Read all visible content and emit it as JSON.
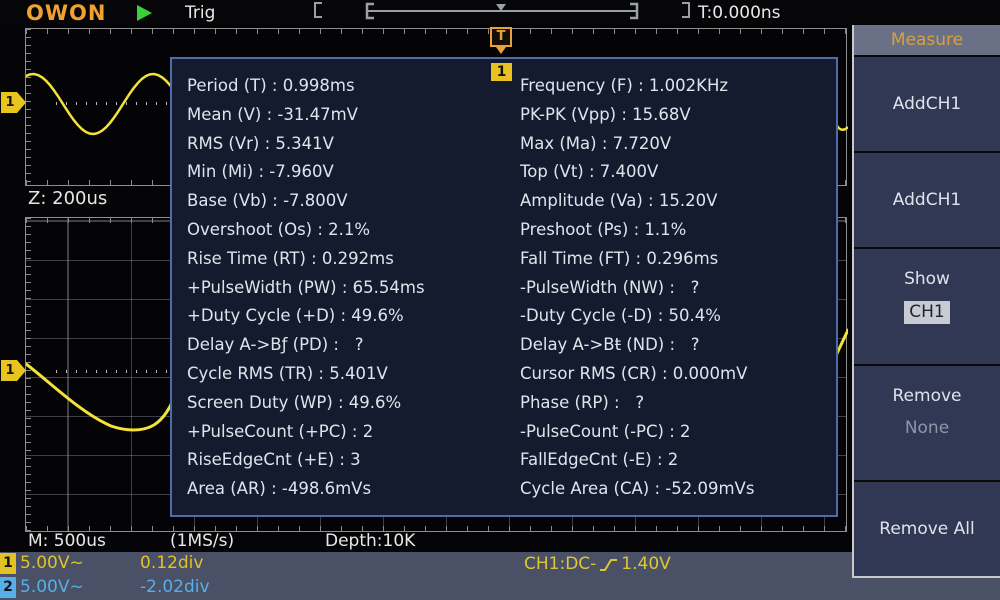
{
  "topbar": {
    "logo": "OWON",
    "trigger_status": "Trig",
    "trigger_time": "T:0.000ns"
  },
  "zoom_window": {
    "label": "Z: 200us"
  },
  "trigger_flag": "T",
  "measure_panel": {
    "channel_badge": "1",
    "left": [
      {
        "label": "Period (T)",
        "value": "0.998ms"
      },
      {
        "label": "Mean (V)",
        "value": "-31.47mV"
      },
      {
        "label": "RMS (Vr)",
        "value": "5.341V"
      },
      {
        "label": "Min (Mi)",
        "value": "-7.960V"
      },
      {
        "label": "Base (Vb)",
        "value": "-7.800V"
      },
      {
        "label": "Overshoot (Os)",
        "value": "2.1%"
      },
      {
        "label": "Rise Time (RT)",
        "value": "0.292ms"
      },
      {
        "label": "+PulseWidth (PW)",
        "value": "65.54ms"
      },
      {
        "label": "+Duty Cycle (+D)",
        "value": "49.6%"
      },
      {
        "label": "Delay A->Bƒ (PD)",
        "value": "  ?"
      },
      {
        "label": "Cycle RMS (TR)",
        "value": "5.401V"
      },
      {
        "label": "Screen Duty (WP)",
        "value": "49.6%"
      },
      {
        "label": "+PulseCount (+PC)",
        "value": "2"
      },
      {
        "label": "RiseEdgeCnt (+E)",
        "value": "3"
      },
      {
        "label": "Area (AR)",
        "value": "-498.6mVs"
      }
    ],
    "right": [
      {
        "label": "Frequency (F)",
        "value": "1.002KHz"
      },
      {
        "label": "PK-PK (Vpp)",
        "value": "15.68V"
      },
      {
        "label": "Max (Ma)",
        "value": "7.720V"
      },
      {
        "label": "Top (Vt)",
        "value": "7.400V"
      },
      {
        "label": "Amplitude (Va)",
        "value": "15.20V"
      },
      {
        "label": "Preshoot (Ps)",
        "value": "1.1%"
      },
      {
        "label": "Fall Time (FT)",
        "value": "0.296ms"
      },
      {
        "label": "-PulseWidth (NW)",
        "value": "  ?"
      },
      {
        "label": "-Duty Cycle (-D)",
        "value": "50.4%"
      },
      {
        "label": "Delay A->Bŧ (ND)",
        "value": "  ?"
      },
      {
        "label": "Cursor RMS (CR)",
        "value": "0.000mV"
      },
      {
        "label": "Phase (RP)",
        "value": "  ?"
      },
      {
        "label": "-PulseCount (-PC)",
        "value": "2"
      },
      {
        "label": "FallEdgeCnt (-E)",
        "value": "2"
      },
      {
        "label": "Cycle Area (CA)",
        "value": "-52.09mVs"
      }
    ]
  },
  "sidebar": {
    "title": "Measure",
    "buttons": [
      {
        "label": "AddCH1"
      },
      {
        "label": "AddCH1"
      },
      {
        "label": "Show",
        "value": "CH1",
        "value_boxed": true
      },
      {
        "label": "Remove",
        "value": "None"
      },
      {
        "label": "Remove All"
      }
    ]
  },
  "status_strip": {
    "timebase": "M: 500us",
    "sample_rate": "(1MS/s)",
    "depth": "Depth:10K"
  },
  "bottom_bar": {
    "channels": [
      {
        "badge": "1",
        "scale": "5.00V~",
        "offset": "0.12div",
        "color": "#e2c227"
      },
      {
        "badge": "2",
        "scale": "5.00V~",
        "offset": "-2.02div",
        "color": "#58aee8"
      }
    ],
    "trigger_info": {
      "source": "CH1:DC-",
      "edge_icon": "rising-edge-icon",
      "level": "1.40V"
    }
  },
  "colors": {
    "accent_orange": "#f0a12f",
    "sidebar_title_orange": "#d9a13c",
    "waveform_yellow": "#f4e23a",
    "trigger_text_yellow": "#ddc832",
    "panel_border_blue": "#4d6da6",
    "ch1_yellow": "#e2c227",
    "ch2_blue": "#58aee8"
  }
}
